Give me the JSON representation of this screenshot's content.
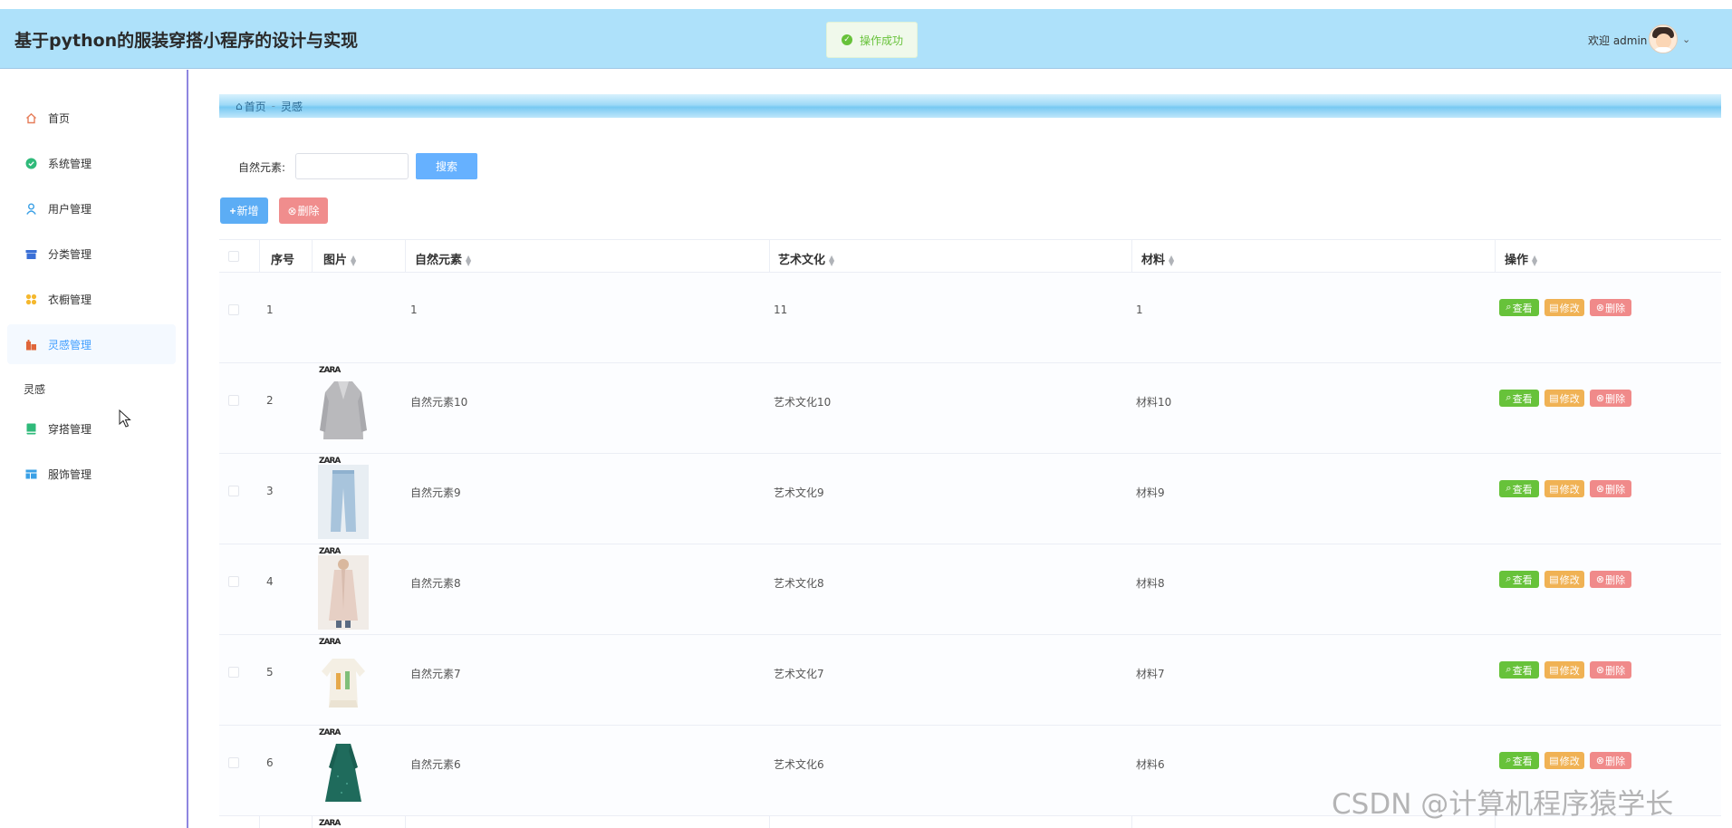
{
  "header": {
    "title": "基于python的服装穿搭小程序的设计与实现",
    "toast": "操作成功",
    "welcome": "欢迎 admin"
  },
  "sidebar": {
    "items": [
      {
        "label": "首页",
        "icon": "home-icon",
        "color": "#e67e5a"
      },
      {
        "label": "系统管理",
        "icon": "circle-check-icon",
        "color": "#2fba7a"
      },
      {
        "label": "用户管理",
        "icon": "user-icon",
        "color": "#3aa0e6"
      },
      {
        "label": "分类管理",
        "icon": "box-icon",
        "color": "#3a6fd6"
      },
      {
        "label": "衣橱管理",
        "icon": "grid-icon",
        "color": "#f5b82e"
      },
      {
        "label": "灵感管理",
        "icon": "buildings-icon",
        "color": "#e0663a"
      },
      {
        "label": "穿搭管理",
        "icon": "book-icon",
        "color": "#2fba7a"
      },
      {
        "label": "服饰管理",
        "icon": "table-icon",
        "color": "#3aa0e6"
      }
    ],
    "sub_item": "灵感",
    "active_index": 5
  },
  "breadcrumb": {
    "home": "首页",
    "current": "灵感"
  },
  "search": {
    "label": "自然元素:",
    "placeholder": "",
    "button": "搜索"
  },
  "actions": {
    "add": "新增",
    "delete": "删除"
  },
  "table": {
    "columns": [
      "序号",
      "图片",
      "自然元素",
      "艺术文化",
      "材料",
      "操作"
    ],
    "op_labels": {
      "view": "查看",
      "edit": "修改",
      "delete": "删除"
    },
    "rows": [
      {
        "index": "1",
        "image": "",
        "natural": "1",
        "art": "11",
        "material": "1"
      },
      {
        "index": "2",
        "image": "gray-coat",
        "brand": "ZARA",
        "natural": "自然元素10",
        "art": "艺术文化10",
        "material": "材料10"
      },
      {
        "index": "3",
        "image": "light-jeans",
        "brand": "ZARA",
        "natural": "自然元素9",
        "art": "艺术文化9",
        "material": "材料9"
      },
      {
        "index": "4",
        "image": "beige-long-coat",
        "brand": "ZARA",
        "natural": "自然元素8",
        "art": "艺术文化8",
        "material": "材料8"
      },
      {
        "index": "5",
        "image": "cream-printed-top",
        "brand": "ZARA",
        "natural": "自然元素7",
        "art": "艺术文化7",
        "material": "材料7"
      },
      {
        "index": "6",
        "image": "green-dress",
        "brand": "ZARA",
        "natural": "自然元素6",
        "art": "艺术文化6",
        "material": "材料6"
      }
    ],
    "next_row_brand": "ZARA"
  },
  "watermark": "CSDN @计算机程序猿学长"
}
